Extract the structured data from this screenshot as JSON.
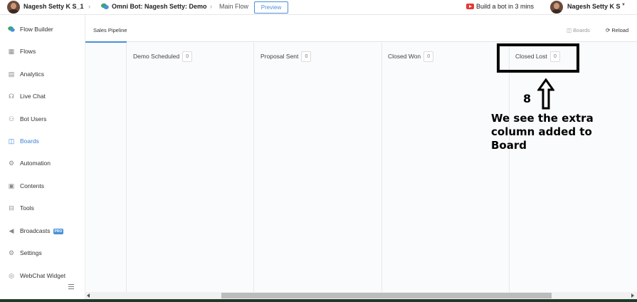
{
  "topbar": {
    "user_name": "Nagesh Setty K S_1",
    "bot_name": "Omni Bot: Nagesh Setty: Demo",
    "flow_name": "Main Flow",
    "preview_label": "Preview",
    "build_bot_label": "Build a bot in 3 mins",
    "account_name": "Nagesh Setty K S",
    "youtube_color": "#e53935",
    "accent_color": "#4a90d9"
  },
  "sidebar": {
    "items": [
      {
        "label": "Flow Builder",
        "icon": "chat-bubbles-icon"
      },
      {
        "label": "Flows",
        "icon": "grid-icon"
      },
      {
        "label": "Analytics",
        "icon": "chart-icon"
      },
      {
        "label": "Live Chat",
        "icon": "headset-icon"
      },
      {
        "label": "Bot Users",
        "icon": "user-icon"
      },
      {
        "label": "Boards",
        "icon": "board-icon",
        "active": true
      },
      {
        "label": "Automation",
        "icon": "gear-cycle-icon"
      },
      {
        "label": "Contents",
        "icon": "content-icon"
      },
      {
        "label": "Tools",
        "icon": "toolbox-icon"
      },
      {
        "label": "Broadcasts",
        "icon": "megaphone-icon",
        "badge": "PRO"
      },
      {
        "label": "Settings",
        "icon": "settings-icon"
      },
      {
        "label": "WebChat Widget",
        "icon": "widget-icon"
      }
    ]
  },
  "main": {
    "tab_label": "Sales Pipeline",
    "boards_label": "Boards",
    "reload_label": "Reload",
    "columns": [
      {
        "title": "Demo Scheduled",
        "count": "0"
      },
      {
        "title": "Proposal Sent",
        "count": "0"
      },
      {
        "title": "Closed Won",
        "count": "0"
      },
      {
        "title": "Closed Lost",
        "count": "0"
      }
    ]
  },
  "annotation": {
    "step_number": "8",
    "line1": "We see the extra",
    "line2": "column added to",
    "line3": "Board"
  }
}
